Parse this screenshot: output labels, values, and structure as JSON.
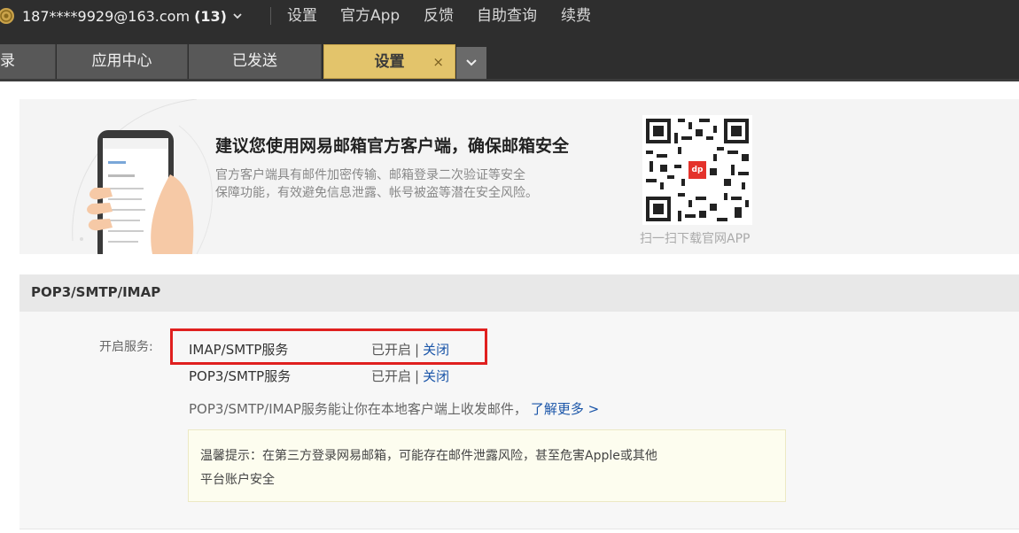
{
  "account": {
    "email": "187****9929@163.com",
    "unread_count": "(13)"
  },
  "top_links": [
    "设置",
    "官方App",
    "反馈",
    "自助查询",
    "续费"
  ],
  "tabs": [
    {
      "label": "录"
    },
    {
      "label": "应用中心"
    },
    {
      "label": "已发送"
    },
    {
      "label": "设置",
      "close": "×"
    }
  ],
  "banner": {
    "title": "建议您使用网易邮箱官方客户端，确保邮箱安全",
    "desc_line1": "官方客户端具有邮件加密传输、邮箱登录二次验证等安全",
    "desc_line2": "保障功能，有效避免信息泄露、帐号被盗等潜在安全风险。",
    "qr_caption": "扫一扫下载官网APP",
    "qr_logo": "dp"
  },
  "section": {
    "title": "POP3/SMTP/IMAP",
    "service_label": "开启服务:",
    "services": [
      {
        "name": "IMAP/SMTP服务",
        "status": "已开启",
        "separator": "|",
        "action": "关闭"
      },
      {
        "name": "POP3/SMTP服务",
        "status": "已开启",
        "separator": "|",
        "action": "关闭"
      }
    ],
    "description": "POP3/SMTP/IMAP服务能让你在本地客户端上收发邮件，",
    "learn_more": "了解更多 >",
    "tip_line1": "温馨提示：在第三方登录网易邮箱，可能存在邮件泄露风险，甚至危害Apple或其他",
    "tip_line2": "平台账户安全"
  },
  "colors": {
    "accent_tab": "#e3c46b",
    "link": "#1a55a8",
    "highlight": "#e0201f"
  }
}
